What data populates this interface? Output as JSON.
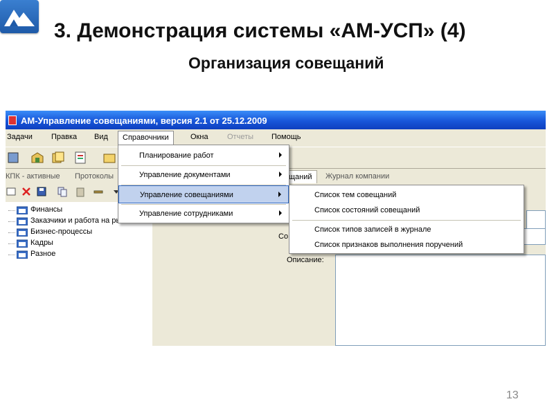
{
  "slide": {
    "title": "3. Демонстрация системы «АМ-УСП» (4)",
    "subtitle": "Организация совещаний",
    "page_number": "13"
  },
  "app": {
    "window_title": "АМ-Управление совещаниями, версия 2.1 от 25.12.2009",
    "menu": [
      "Задачи",
      "Правка",
      "Вид",
      "Справочники",
      "Окна",
      "Отчеты",
      "Помощь"
    ],
    "tabs": [
      "КПК - активные",
      "Протоколы",
      "щаний",
      "Журнал компании"
    ],
    "tree": [
      "Финансы",
      "Заказчики и работа на рынке",
      "Бизнес-процессы",
      "Кадры",
      "Разное"
    ],
    "fields": {
      "partial_label": "Со",
      "description_label": "Описание:"
    },
    "reference_menu": [
      "Планирование работ",
      "Управление документами",
      "Управление совещаниями",
      "Управление сотрудниками"
    ],
    "meetings_submenu": [
      "Список тем совещаний",
      "Список состояний совещаний",
      "Список типов записей в журнале",
      "Список признаков выполнения поручений"
    ]
  },
  "colors": {
    "titlebar": "#1856d9",
    "highlight": "#c1d2ee",
    "highlight_border": "#316ac5"
  }
}
